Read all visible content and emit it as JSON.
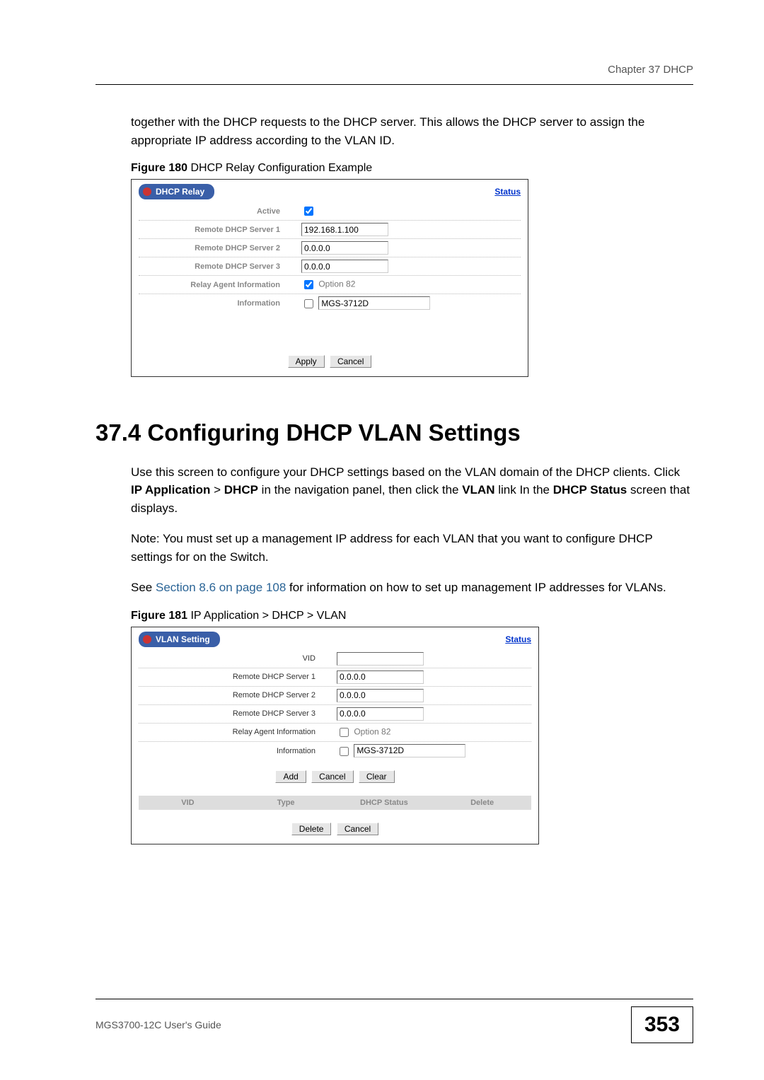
{
  "header": {
    "chapter": "Chapter 37 DHCP"
  },
  "intro_para": "together with the DHCP requests to the DHCP server. This allows the DHCP server to assign the appropriate IP address according to the VLAN ID.",
  "fig180": {
    "caption_num": "Figure 180",
    "caption_text": "   DHCP Relay Configuration Example",
    "tab_title": "DHCP Relay",
    "status_link": "Status",
    "rows": {
      "active": "Active",
      "server1": "Remote DHCP Server 1",
      "server2": "Remote DHCP Server 2",
      "server3": "Remote DHCP Server 3",
      "rai": "Relay Agent Information",
      "info": "Information"
    },
    "values": {
      "server1": "192.168.1.100",
      "server2": "0.0.0.0",
      "server3": "0.0.0.0",
      "option82": "Option 82",
      "info": "MGS-3712D"
    },
    "buttons": {
      "apply": "Apply",
      "cancel": "Cancel"
    }
  },
  "section": {
    "title": "37.4  Configuring DHCP VLAN Settings",
    "para1_a": "Use this screen to configure your DHCP settings based on the VLAN domain of the DHCP clients. Click ",
    "para1_nav1": "IP Application",
    "para1_b": " > ",
    "para1_nav2": "DHCP",
    "para1_c": " in the navigation panel, then click the ",
    "para1_nav3": "VLAN",
    "para1_d": " link In the ",
    "para1_nav4": "DHCP Status",
    "para1_e": " screen that displays.",
    "note": "Note: You must set up a management IP address for each VLAN that you want to configure DHCP settings for on the Switch.",
    "para2_a": "See ",
    "para2_link": "Section 8.6 on page 108",
    "para2_b": " for information on how to set up management IP addresses for VLANs."
  },
  "fig181": {
    "caption_num": "Figure 181",
    "caption_text": "   IP Application > DHCP > VLAN",
    "tab_title": "VLAN Setting",
    "status_link": "Status",
    "rows": {
      "vid": "VID",
      "server1": "Remote DHCP Server 1",
      "server2": "Remote DHCP Server 2",
      "server3": "Remote DHCP Server 3",
      "rai": "Relay Agent Information",
      "info": "Information"
    },
    "values": {
      "vid": "",
      "server1": "0.0.0.0",
      "server2": "0.0.0.0",
      "server3": "0.0.0.0",
      "option82": "Option 82",
      "info": "MGS-3712D"
    },
    "buttons": {
      "add": "Add",
      "cancel": "Cancel",
      "clear": "Clear",
      "delete": "Delete",
      "cancel2": "Cancel"
    },
    "table_headers": {
      "vid": "VID",
      "type": "Type",
      "dhcp": "DHCP Status",
      "delete": "Delete"
    }
  },
  "footer": {
    "guide": "MGS3700-12C User's Guide",
    "page": "353"
  }
}
